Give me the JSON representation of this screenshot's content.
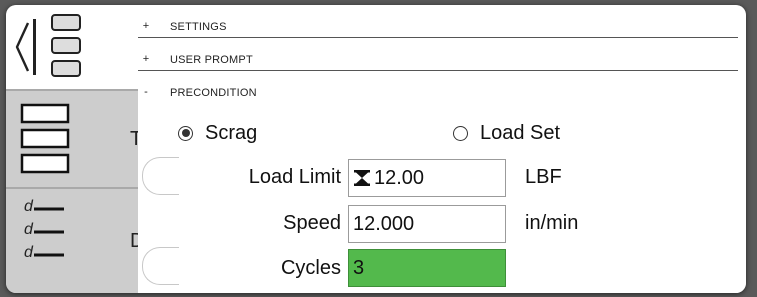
{
  "sections": [
    {
      "mark": "+",
      "title": "SETTINGS"
    },
    {
      "mark": "+",
      "title": "USER PROMPT"
    },
    {
      "mark": "-",
      "title": "PRECONDITION"
    }
  ],
  "precondition": {
    "mode_options": [
      {
        "label": "Scrag",
        "selected": true
      },
      {
        "label": "Load Set",
        "selected": false
      }
    ],
    "fields": [
      {
        "label": "Load Limit",
        "value": "12.00",
        "unit": "LBF",
        "icon": "hourglass-icon"
      },
      {
        "label": "Speed",
        "value": "12.000",
        "unit": "in/min"
      },
      {
        "label": "Cycles",
        "value": "3",
        "highlight_color": "#53b94c"
      }
    ]
  },
  "sidebar": {
    "peek_upper": "T",
    "peek_lower": "D",
    "list_item_prefix": [
      "d",
      "d",
      "d"
    ]
  }
}
